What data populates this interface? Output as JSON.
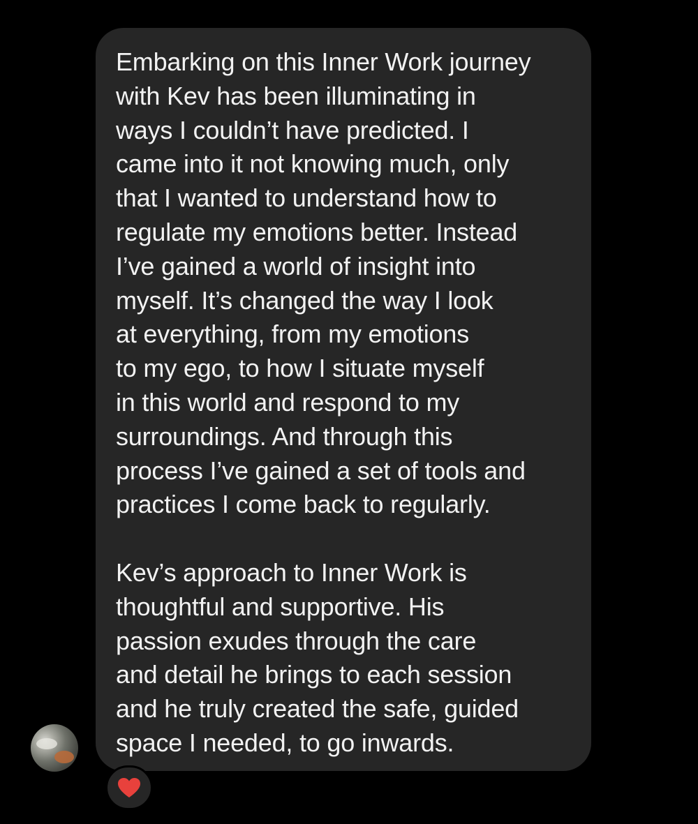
{
  "message": {
    "lines": [
      "Embarking on this Inner Work journey",
      "with Kev has been illuminating in",
      "ways I couldn’t have predicted. I",
      "came into it not knowing much, only",
      "that I wanted to understand how to",
      "regulate my emotions better. Instead",
      "I’ve gained a world of insight into",
      "myself. It’s changed the way I look",
      "at everything, from my emotions",
      "to my ego, to how I situate myself",
      "in this world and respond to my",
      "surroundings. And through this",
      "process I’ve gained a set of tools and",
      "practices I come back to regularly.",
      "",
      "Kev’s approach to Inner Work is",
      "thoughtful and supportive. His",
      "passion exudes through the care",
      "and detail he brings to each session",
      "and he truly created the safe, guided",
      "space I needed, to go inwards."
    ]
  },
  "reaction": {
    "icon": "heart-icon",
    "color": "#e8413c"
  },
  "colors": {
    "background": "#000000",
    "bubble": "#262626",
    "text": "#f2f2f2"
  }
}
